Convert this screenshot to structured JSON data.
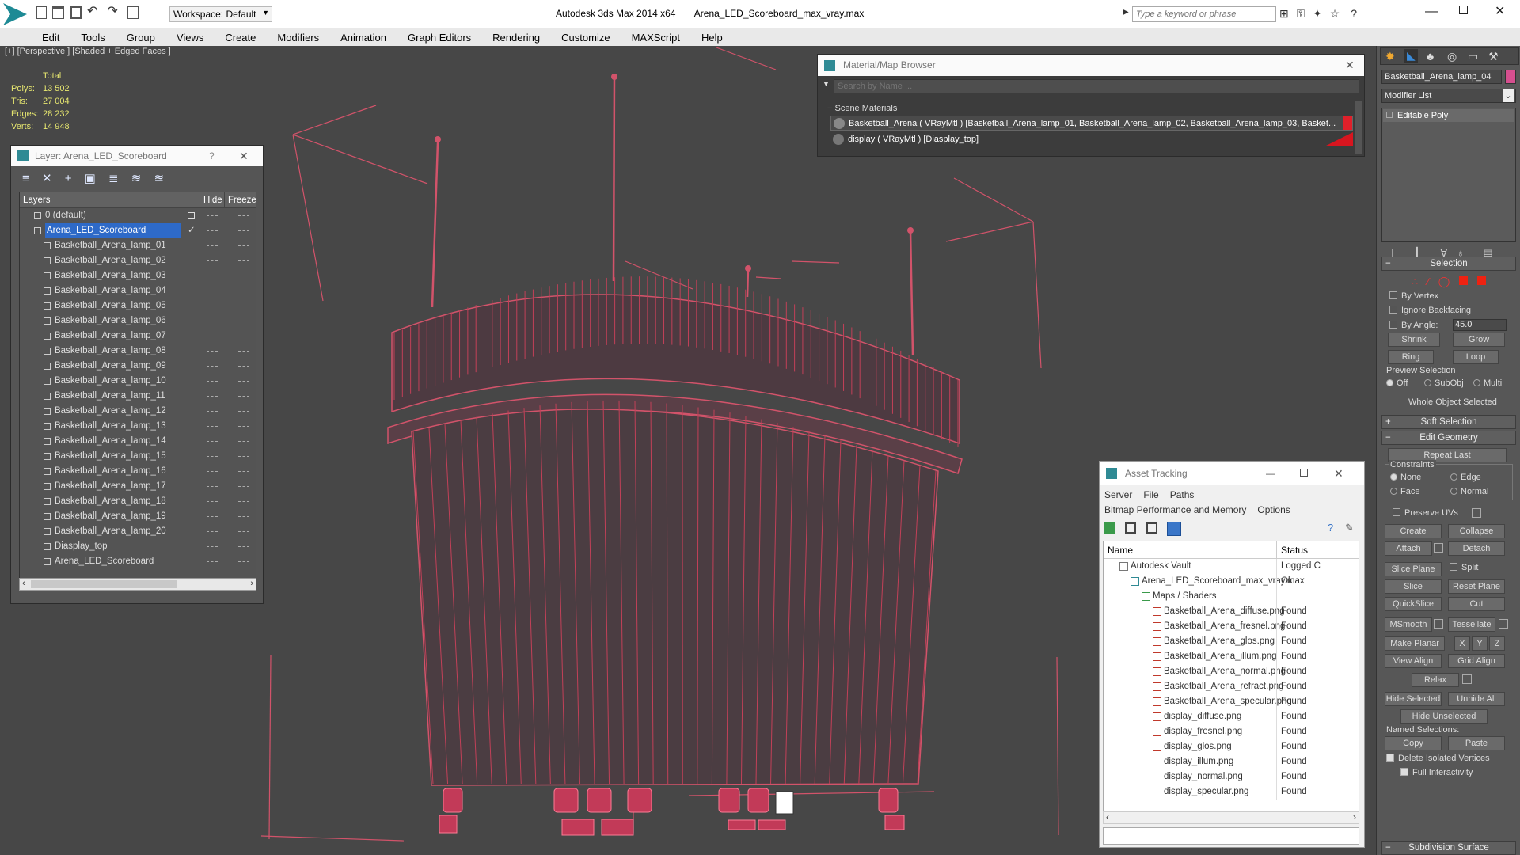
{
  "titlebar": {
    "workspace": "Workspace: Default",
    "app_title": "Autodesk 3ds Max  2014 x64",
    "file_title": "Arena_LED_Scoreboard_max_vray.max",
    "search_placeholder": "Type a keyword or phrase"
  },
  "menu": [
    "Edit",
    "Tools",
    "Group",
    "Views",
    "Create",
    "Modifiers",
    "Animation",
    "Graph Editors",
    "Rendering",
    "Customize",
    "MAXScript",
    "Help"
  ],
  "viewport": {
    "label": "[+] [Perspective ] [Shaded + Edged Faces ]",
    "stats": {
      "total_label": "Total",
      "rows": [
        {
          "label": "Polys:",
          "value": "13 502"
        },
        {
          "label": "Tris:",
          "value": "27 004"
        },
        {
          "label": "Edges:",
          "value": "28 232"
        },
        {
          "label": "Verts:",
          "value": "14 948"
        }
      ]
    }
  },
  "layer_panel": {
    "title": "Layer: Arena_LED_Scoreboard",
    "help": "?",
    "col_layers": "Layers",
    "col_hide": "Hide",
    "col_freeze": "Freeze",
    "rows": [
      "0 (default)",
      "Arena_LED_Scoreboard",
      "Basketball_Arena_lamp_01",
      "Basketball_Arena_lamp_02",
      "Basketball_Arena_lamp_03",
      "Basketball_Arena_lamp_04",
      "Basketball_Arena_lamp_05",
      "Basketball_Arena_lamp_06",
      "Basketball_Arena_lamp_07",
      "Basketball_Arena_lamp_08",
      "Basketball_Arena_lamp_09",
      "Basketball_Arena_lamp_10",
      "Basketball_Arena_lamp_11",
      "Basketball_Arena_lamp_12",
      "Basketball_Arena_lamp_13",
      "Basketball_Arena_lamp_14",
      "Basketball_Arena_lamp_15",
      "Basketball_Arena_lamp_16",
      "Basketball_Arena_lamp_17",
      "Basketball_Arena_lamp_18",
      "Basketball_Arena_lamp_19",
      "Basketball_Arena_lamp_20",
      "Diasplay_top",
      "Arena_LED_Scoreboard"
    ]
  },
  "material_browser": {
    "title": "Material/Map Browser",
    "search_placeholder": "Search by Name ...",
    "section": "Scene Materials",
    "items": [
      "Basketball_Arena ( VRayMtl ) [Basketball_Arena_lamp_01, Basketball_Arena_lamp_02, Basketball_Arena_lamp_03, Basket...",
      "display ( VRayMtl ) [Diasplay_top]"
    ]
  },
  "asset_tracking": {
    "title": "Asset Tracking",
    "menu": [
      "Server",
      "File",
      "Paths",
      "Bitmap Performance and Memory",
      "Options"
    ],
    "col_name": "Name",
    "col_status": "Status",
    "rows": [
      {
        "name": "Autodesk Vault",
        "status": "Logged C",
        "indent": 1
      },
      {
        "name": "Arena_LED_Scoreboard_max_vray.max",
        "status": "Ok",
        "indent": 2
      },
      {
        "name": "Maps / Shaders",
        "status": "",
        "indent": 3
      },
      {
        "name": "Basketball_Arena_diffuse.png",
        "status": "Found",
        "indent": 4
      },
      {
        "name": "Basketball_Arena_fresnel.png",
        "status": "Found",
        "indent": 4
      },
      {
        "name": "Basketball_Arena_glos.png",
        "status": "Found",
        "indent": 4
      },
      {
        "name": "Basketball_Arena_illum.png",
        "status": "Found",
        "indent": 4
      },
      {
        "name": "Basketball_Arena_normal.png",
        "status": "Found",
        "indent": 4
      },
      {
        "name": "Basketball_Arena_refract.png",
        "status": "Found",
        "indent": 4
      },
      {
        "name": "Basketball_Arena_specular.png",
        "status": "Found",
        "indent": 4
      },
      {
        "name": "display_diffuse.png",
        "status": "Found",
        "indent": 4
      },
      {
        "name": "display_fresnel.png",
        "status": "Found",
        "indent": 4
      },
      {
        "name": "display_glos.png",
        "status": "Found",
        "indent": 4
      },
      {
        "name": "display_illum.png",
        "status": "Found",
        "indent": 4
      },
      {
        "name": "display_normal.png",
        "status": "Found",
        "indent": 4
      },
      {
        "name": "display_specular.png",
        "status": "Found",
        "indent": 4
      }
    ]
  },
  "command_panel": {
    "object_name": "Basketball_Arena_lamp_04",
    "modifier_list": "Modifier List",
    "stack_item": "Editable Poly",
    "selection": {
      "header": "Selection",
      "by_vertex": "By Vertex",
      "ignore_backfacing": "Ignore Backfacing",
      "by_angle": "By Angle:",
      "angle_value": "45.0",
      "shrink": "Shrink",
      "grow": "Grow",
      "ring": "Ring",
      "loop": "Loop",
      "preview_selection": "Preview Selection",
      "off": "Off",
      "subobj": "SubObj",
      "multi": "Multi",
      "status": "Whole Object Selected"
    },
    "soft_selection": "Soft Selection",
    "edit_geometry": {
      "header": "Edit Geometry",
      "repeat_last": "Repeat Last",
      "constraints": "Constraints",
      "none": "None",
      "edge": "Edge",
      "face": "Face",
      "normal": "Normal",
      "preserve_uvs": "Preserve UVs",
      "create": "Create",
      "collapse": "Collapse",
      "attach": "Attach",
      "detach": "Detach",
      "slice_plane": "Slice Plane",
      "split": "Split",
      "slice": "Slice",
      "reset_plane": "Reset Plane",
      "quickslice": "QuickSlice",
      "cut": "Cut",
      "msmooth": "MSmooth",
      "tessellate": "Tessellate",
      "make_planar": "Make Planar",
      "x": "X",
      "y": "Y",
      "z": "Z",
      "view_align": "View Align",
      "grid_align": "Grid Align",
      "relax": "Relax",
      "hide_selected": "Hide Selected",
      "unhide_all": "Unhide All",
      "hide_unselected": "Hide Unselected",
      "named_selections": "Named Selections:",
      "copy": "Copy",
      "paste": "Paste",
      "delete_isolated": "Delete Isolated Vertices",
      "full_interactivity": "Full Interactivity"
    },
    "subdivision_surface": "Subdivision Surface"
  },
  "colors": {
    "wire": "#c8415a",
    "accent": "#3d7bbf",
    "selected_row": "#2e6ac8",
    "swatch": "#d64f8f"
  }
}
